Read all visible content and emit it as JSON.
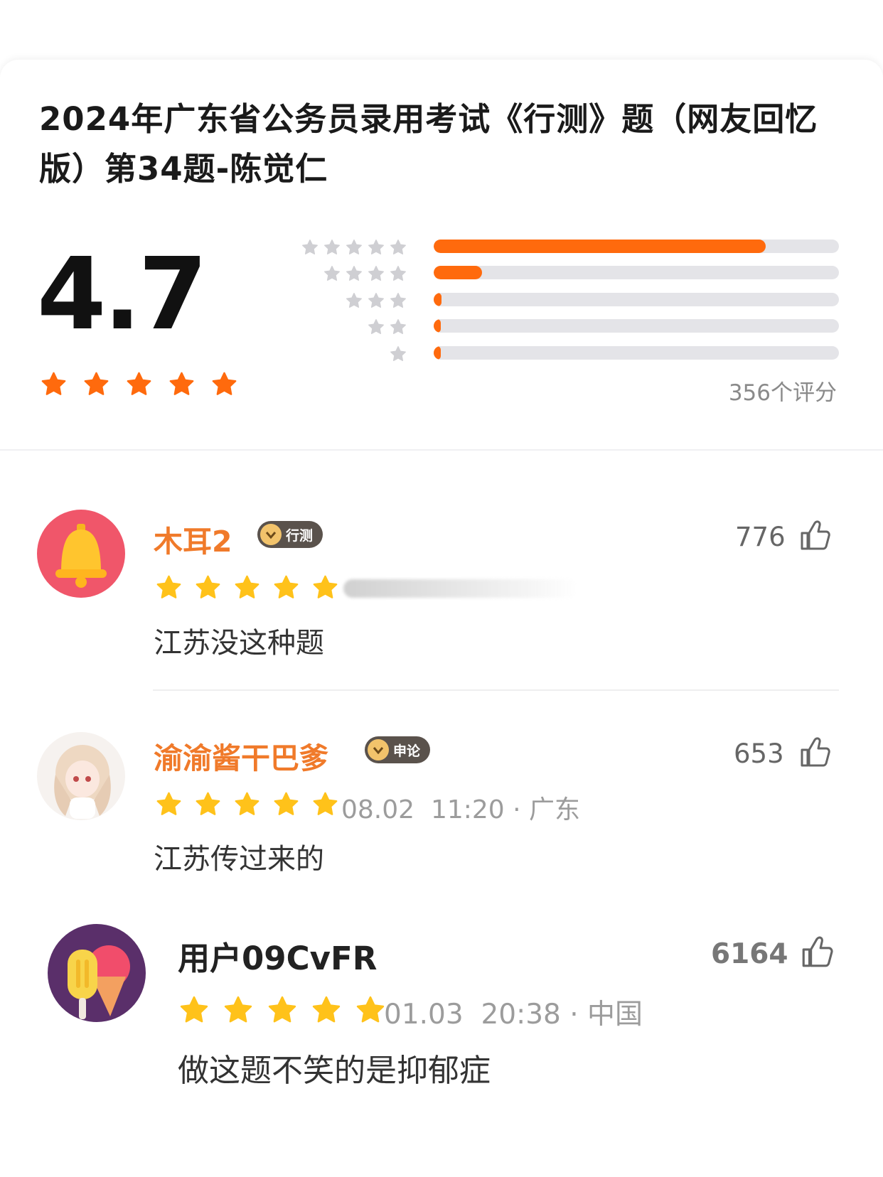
{
  "question": {
    "title": "2024年广东省公务员录用考试《行测》题（网友回忆版）第34题-陈觉仁"
  },
  "rating": {
    "score": "4.7",
    "stars": 5,
    "count_label": "356个评分",
    "distribution": [
      {
        "stars": 5,
        "fraction": 0.82
      },
      {
        "stars": 4,
        "fraction": 0.12
      },
      {
        "stars": 3,
        "fraction": 0.02
      },
      {
        "stars": 2,
        "fraction": 0.015
      },
      {
        "stars": 1,
        "fraction": 0.015
      }
    ],
    "bar_color": "#ff6a0d",
    "track_color": "#e4e4e8",
    "star_color": "#ff6a0d"
  },
  "reviews": [
    {
      "name": "木耳2",
      "name_color": "#f07a2a",
      "badge": "行测",
      "likes": "776",
      "stars": 5,
      "meta": "",
      "text": "江苏没这种题",
      "avatar": "bell-avatar"
    },
    {
      "name": "渝渝酱干巴爹",
      "name_color": "#f07a2a",
      "badge": "申论",
      "likes": "653",
      "stars": 5,
      "meta": "08.02  11:20 · 广东",
      "text": "江苏传过来的",
      "avatar": "anime-avatar"
    },
    {
      "name": "用户09CvFR",
      "name_color": "#222222",
      "badge": "",
      "likes": "6164",
      "stars": 5,
      "meta": "01.03  20:38 · 中国",
      "text": "做这题不笑的是抑郁症",
      "avatar": "icecream-avatar"
    }
  ],
  "review_star_color": "#ffc21a"
}
